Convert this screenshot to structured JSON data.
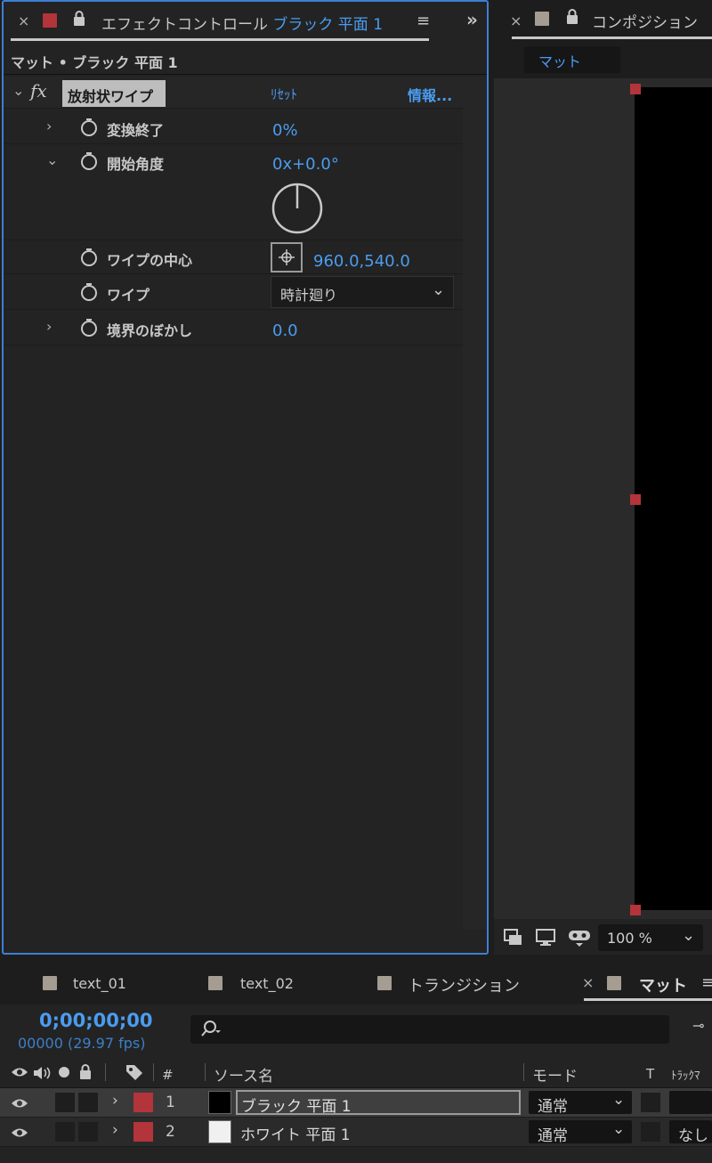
{
  "effect_controls": {
    "tab_title_prefix": "エフェクトコントロール",
    "tab_title_layer": "ブラック 平面 1",
    "subheader": "マット • ブラック 平面 1",
    "effect_name": "放射状ワイプ",
    "reset_label": "ﾘｾｯﾄ",
    "about_label": "情報...",
    "fx_label": "fx",
    "params": [
      {
        "label": "変換終了",
        "value": "0%"
      },
      {
        "label": "開始角度",
        "value": "0x+0.0°"
      },
      {
        "label": "ワイプの中心",
        "value": "960.0,540.0"
      },
      {
        "label": "ワイプ",
        "value": "時計廻り"
      },
      {
        "label": "境界のぼかし",
        "value": "0.0"
      }
    ]
  },
  "composition": {
    "tab_title": "コンポジション",
    "breadcrumb": "マット",
    "zoom": "100 %"
  },
  "timeline": {
    "tabs": [
      "text_01",
      "text_02",
      "トランジション",
      "マット"
    ],
    "timecode": "0;00;00;00",
    "frame_info": "00000 (29.97 fps)",
    "columns": {
      "hash": "#",
      "source_name": "ソース名",
      "mode": "モード",
      "t": "T",
      "track_matte": "ﾄﾗｯｸﾏ"
    },
    "layers": [
      {
        "num": "1",
        "name": "ブラック 平面 1",
        "mode": "通常",
        "matte": "",
        "color": "#000000"
      },
      {
        "num": "2",
        "name": "ホワイト 平面 1",
        "mode": "通常",
        "matte": "なし",
        "color": "#f0f0f0"
      }
    ]
  },
  "colors": {
    "accent": "#4b9cf0",
    "label_red": "#b3343a",
    "panel_border": "#3e7fd3"
  }
}
